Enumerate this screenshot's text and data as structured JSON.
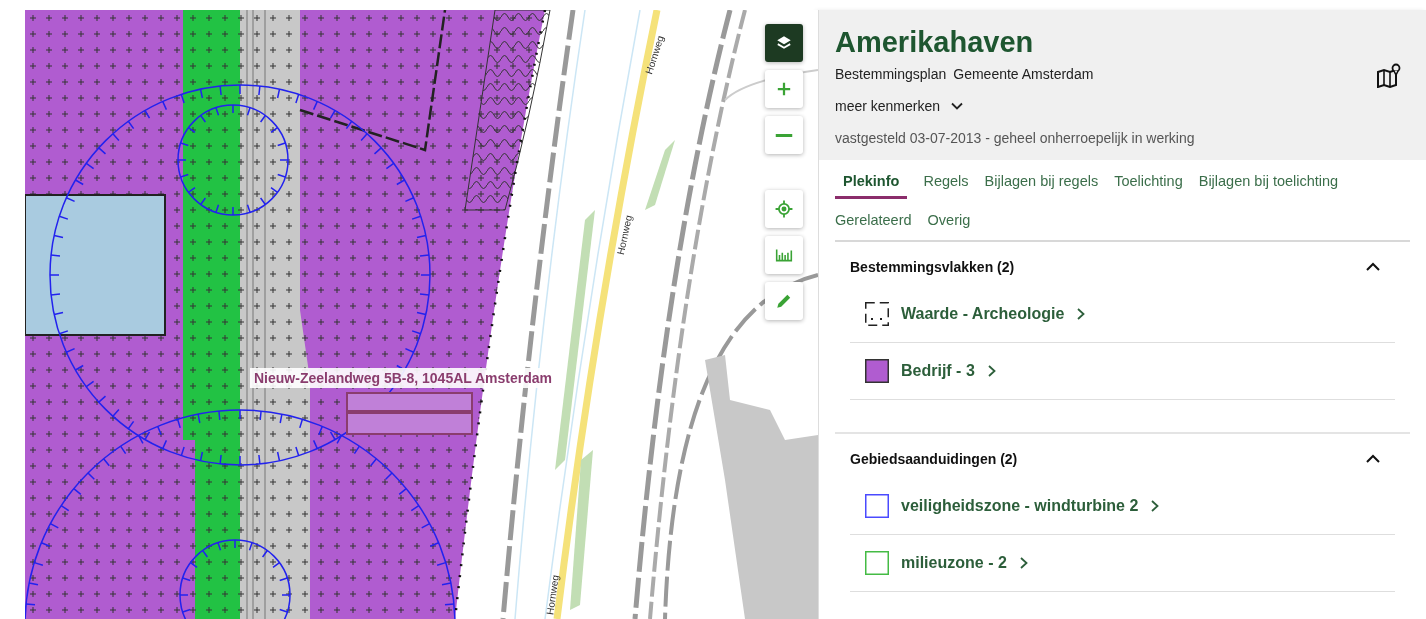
{
  "map": {
    "address_label": "Nieuw-Zeelandweg 5B-8, 1045AL Amsterdam",
    "road_labels": [
      "Hornweg",
      "Hornweg",
      "Hornweg"
    ]
  },
  "map_controls": [
    {
      "kind": "layers",
      "active": true
    },
    {
      "kind": "zoom-in",
      "active": false
    },
    {
      "kind": "zoom-out",
      "active": false
    },
    {
      "kind": "locate",
      "active": false
    },
    {
      "kind": "measure",
      "active": false
    },
    {
      "kind": "draw",
      "active": false
    }
  ],
  "panel": {
    "title": "Amerikahaven",
    "plan_type": "Bestemmingsplan",
    "authority": "Gemeente Amsterdam",
    "more_toggle": {
      "label": "meer kenmerken",
      "expanded": false
    },
    "status": "vastgesteld 03-07-2013 - geheel onherroepelijk in werking"
  },
  "tabs": [
    {
      "label": "Plekinfo",
      "selected": true
    },
    {
      "label": "Regels",
      "selected": false
    },
    {
      "label": "Bijlagen bij regels",
      "selected": false
    },
    {
      "label": "Toelichting",
      "selected": false
    },
    {
      "label": "Bijlagen bij toelichting",
      "selected": false
    },
    {
      "label": "Gerelateerd",
      "selected": false
    },
    {
      "label": "Overig",
      "selected": false
    }
  ],
  "sections": [
    {
      "title": "Bestemmingsvlakken (2)",
      "expanded": true,
      "items": [
        {
          "label": "Waarde - Archeologie",
          "kind": "dashed",
          "color": "#222222"
        },
        {
          "label": "Bedrijf - 3",
          "kind": "fill",
          "color": "#b05cd0"
        }
      ]
    },
    {
      "title": "Gebiedsaanduidingen (2)",
      "expanded": true,
      "items": [
        {
          "label": "veiligheidszone - windturbine 2",
          "kind": "outline",
          "color": "#4a4aff"
        },
        {
          "label": "milieuzone - 2",
          "kind": "outline",
          "color": "#44bb44"
        }
      ]
    }
  ]
}
